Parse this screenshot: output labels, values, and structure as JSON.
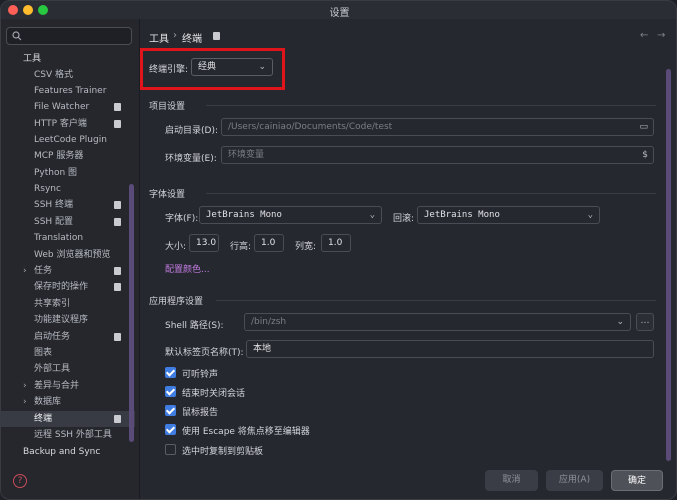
{
  "window": {
    "title": "设置"
  },
  "sidebar": {
    "search_placeholder": "",
    "items": [
      {
        "label": "工具",
        "pinned": false
      },
      {
        "label": "CSV 格式",
        "pinned": false
      },
      {
        "label": "Features Trainer",
        "pinned": false
      },
      {
        "label": "File Watcher",
        "pinned": true
      },
      {
        "label": "HTTP 客户端",
        "pinned": true
      },
      {
        "label": "LeetCode Plugin",
        "pinned": false
      },
      {
        "label": "MCP 服务器",
        "pinned": false
      },
      {
        "label": "Python 图",
        "pinned": false
      },
      {
        "label": "Rsync",
        "pinned": false
      },
      {
        "label": "SSH 终端",
        "pinned": true
      },
      {
        "label": "SSH 配置",
        "pinned": true
      },
      {
        "label": "Translation",
        "pinned": false
      },
      {
        "label": "Web 浏览器和预览",
        "pinned": false
      },
      {
        "label": "任务",
        "pinned": true
      },
      {
        "label": "保存时的操作",
        "pinned": true
      },
      {
        "label": "共享索引",
        "pinned": false
      },
      {
        "label": "功能建议程序",
        "pinned": false
      },
      {
        "label": "启动任务",
        "pinned": true
      },
      {
        "label": "图表",
        "pinned": false
      },
      {
        "label": "外部工具",
        "pinned": false
      },
      {
        "label": "差异与合并",
        "pinned": false
      },
      {
        "label": "数据库",
        "pinned": false
      },
      {
        "label": "终端",
        "pinned": true
      },
      {
        "label": "远程 SSH 外部工具",
        "pinned": false
      },
      {
        "label": "Backup and Sync",
        "pinned": false
      }
    ]
  },
  "breadcrumb": {
    "parent": "工具",
    "separator": "›",
    "current": "终端"
  },
  "engine": {
    "label": "终端引擎:",
    "value": "经典"
  },
  "project": {
    "title": "项目设置",
    "start_dir_label": "启动目录(D):",
    "start_dir_value": "/Users/cainiao/Documents/Code/test",
    "env_label": "环境变量(E):",
    "env_placeholder": "环境变量"
  },
  "font": {
    "title": "字体设置",
    "font_label": "字体(F):",
    "font_value": "JetBrains Mono",
    "fallback_label": "回滚:",
    "fallback_value": "JetBrains Mono",
    "size_label": "大小:",
    "size_value": "13.0",
    "line_height_label": "行高:",
    "line_height_value": "1.0",
    "col_width_label": "列宽:",
    "col_width_value": "1.0",
    "color_link": "配置颜色..."
  },
  "app": {
    "title": "应用程序设置",
    "shell_label": "Shell 路径(S):",
    "shell_value": "/bin/zsh",
    "tab_name_label": "默认标签页名称(T):",
    "tab_name_value": "本地",
    "checkboxes": [
      {
        "label": "可听铃声",
        "checked": true
      },
      {
        "label": "结束时关闭会话",
        "checked": true
      },
      {
        "label": "鼠标报告",
        "checked": true
      },
      {
        "label": "使用 Escape 将焦点移至编辑器",
        "checked": true
      },
      {
        "label": "选中时复制到剪贴板",
        "checked": false
      }
    ]
  },
  "buttons": {
    "cancel": "取消",
    "apply": "应用(A)",
    "ok": "确定"
  },
  "colors": {
    "accent": "#3f7de2",
    "highlight": "#e0141b",
    "link": "#c27ce0"
  }
}
